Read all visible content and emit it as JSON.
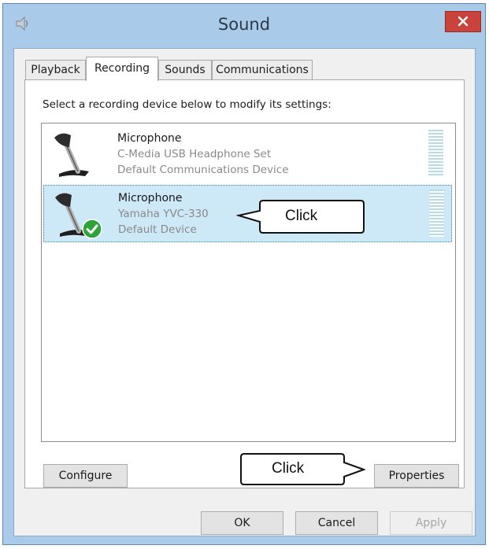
{
  "window": {
    "title": "Sound"
  },
  "tabs": [
    {
      "label": "Playback"
    },
    {
      "label": "Recording",
      "active": true
    },
    {
      "label": "Sounds"
    },
    {
      "label": "Communications"
    }
  ],
  "instruction": "Select a recording device below to modify its settings:",
  "devices": [
    {
      "name": "Microphone",
      "detail": "C-Media USB Headphone Set",
      "status": "Default Communications Device",
      "selected": false
    },
    {
      "name": "Microphone",
      "detail": "Yamaha YVC-330",
      "status": "Default Device",
      "selected": true
    }
  ],
  "buttons": {
    "configure": "Configure",
    "properties": "Properties",
    "ok": "OK",
    "cancel": "Cancel",
    "apply": "Apply"
  },
  "callouts": {
    "device_click": "Click",
    "properties_click": "Click"
  },
  "icons": {
    "app": "speaker-icon",
    "close": "close-icon",
    "device": "microphone-icon",
    "default_badge": "check-icon"
  },
  "colors": {
    "window_frame": "#a9cbe9",
    "close_button": "#c9433c",
    "selection": "#cde8f7",
    "check_badge": "#2fa33a"
  }
}
